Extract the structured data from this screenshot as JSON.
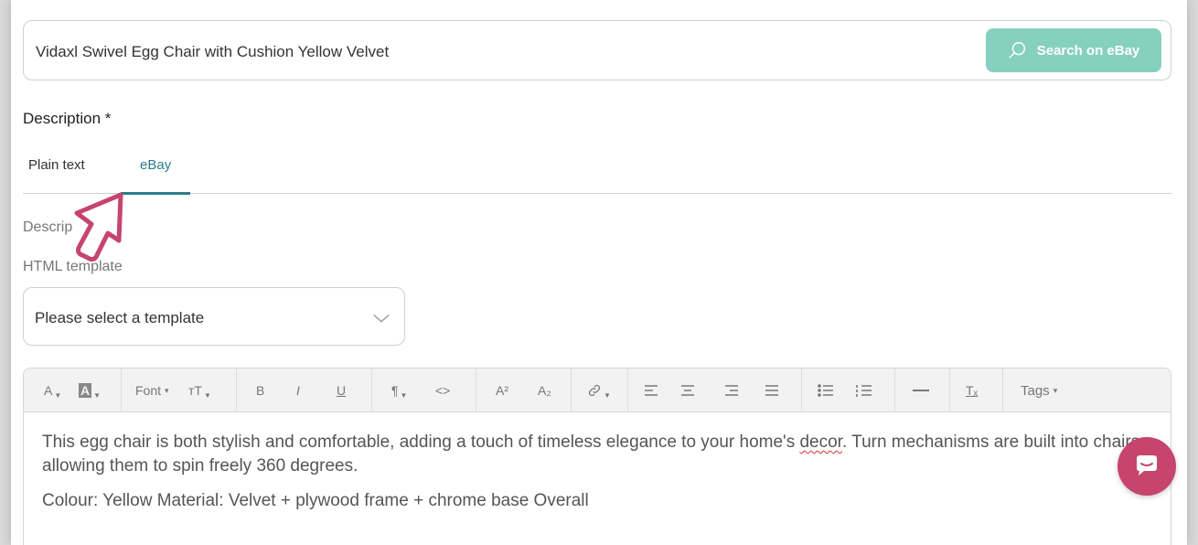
{
  "search": {
    "value": "Vidaxl Swivel Egg Chair with Cushion Yellow Velvet",
    "button_label": "Search on eBay"
  },
  "description": {
    "label": "Description *",
    "tabs": [
      {
        "label": "Plain text",
        "active": false
      },
      {
        "label": "eBay",
        "active": true
      }
    ],
    "sub_label": "Descrip",
    "template_label": "HTML template",
    "template_select": {
      "placeholder": "Please select a template"
    }
  },
  "editor": {
    "toolbar": {
      "font_label": "Font",
      "tags_label": "Tags",
      "glyph_font_color": "A",
      "glyph_bg_color": "A",
      "glyph_font_size": "тT",
      "glyph_bold": "B",
      "glyph_italic": "I",
      "glyph_underline": "U",
      "glyph_paragraph": "¶",
      "glyph_code": "<>",
      "glyph_superscript": "A²",
      "glyph_subscript": "A₂",
      "glyph_clear": "Tₓ"
    },
    "paragraphs": [
      {
        "before": "This egg chair is both stylish and comfortable, adding a touch of timeless elegance to your home's ",
        "misspelled": "decor",
        "after": ". Turn mechanisms are built into chairs, allowing them to spin freely 360 degrees."
      },
      {
        "text": "Colour: Yellow Material: Velvet + plywood frame + chrome base Overall"
      }
    ]
  },
  "colors": {
    "accent": "#2f7d8c",
    "search_button": "#86d0bf",
    "chat_bubble": "#c6446e",
    "cursor_annotation": "#c6446e"
  }
}
